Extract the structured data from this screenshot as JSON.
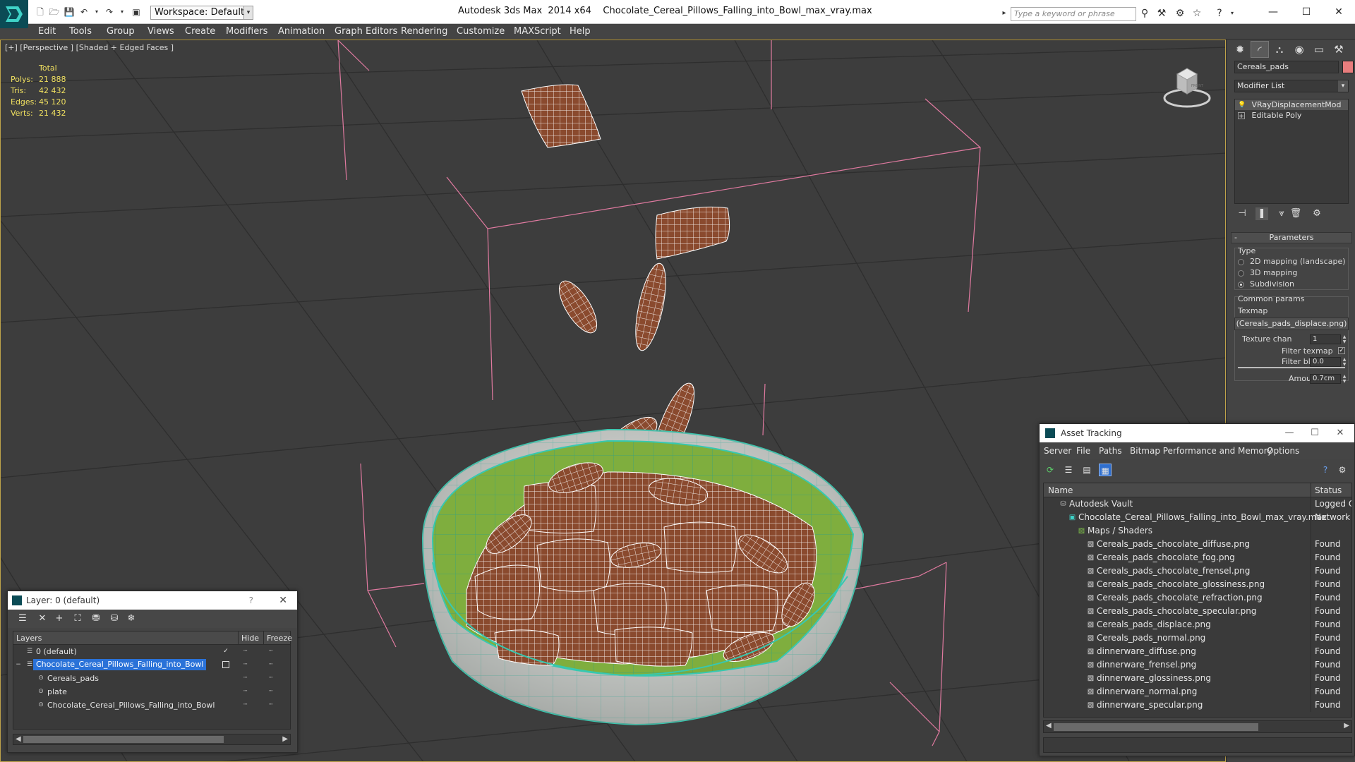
{
  "titlebar": {
    "workspace_label": "Workspace: Default",
    "app_name": "Autodesk 3ds Max  2014 x64",
    "file_name": "Chocolate_Cereal_Pillows_Falling_into_Bowl_max_vray.max",
    "search_placeholder": "Type a keyword or phrase",
    "quick_access_icons": [
      "new-file-icon",
      "open-file-icon",
      "save-icon",
      "undo-icon",
      "redo-icon",
      "project-icon"
    ],
    "window_buttons": [
      "minimize",
      "maximize",
      "close"
    ]
  },
  "menubar": {
    "items": [
      "Edit",
      "Tools",
      "Group",
      "Views",
      "Create",
      "Modifiers",
      "Animation",
      "Graph Editors",
      "Rendering",
      "Customize",
      "MAXScript",
      "Help"
    ]
  },
  "viewport": {
    "label": "[+] [Perspective ] [Shaded + Edged Faces ]",
    "stats": {
      "header": "Total",
      "polys_label": "Polys:",
      "polys": "21 888",
      "tris_label": "Tris:",
      "tris": "42 432",
      "edges_label": "Edges:",
      "edges": "45 120",
      "verts_label": "Verts:",
      "verts": "21 432"
    },
    "viewcube_face": "FRONT",
    "colors": {
      "background": "#3d3d3d",
      "grid": "#2e2e2e",
      "bounding_box": "#e07aa0",
      "cereal": "#8a4a2e",
      "wire": "#ffffff",
      "bowl_inside": "#7fae3e",
      "bowl_outside": "#cfd2cf",
      "bowl_edges": "#37c8b0"
    }
  },
  "command_panel": {
    "tabs": [
      "create-icon",
      "modify-icon",
      "hierarchy-icon",
      "motion-icon",
      "display-icon",
      "utilities-icon"
    ],
    "object_name": "Cereals_pads",
    "object_color": "#e87d7d",
    "modifier_list_label": "Modifier List",
    "stack": [
      {
        "label": "VRayDisplacementMod",
        "selected": true
      },
      {
        "label": "Editable Poly",
        "selected": false
      }
    ],
    "params": {
      "title": "Parameters",
      "type_label": "Type",
      "type_options": [
        {
          "label": "2D mapping (landscape)",
          "selected": false
        },
        {
          "label": "3D mapping",
          "selected": false
        },
        {
          "label": "Subdivision",
          "selected": true
        }
      ],
      "common_label": "Common params",
      "texmap_label": "Texmap",
      "texmap_value": "(Cereals_pads_displace.png)",
      "texture_chan_label": "Texture chan",
      "texture_chan_value": "1",
      "filter_texmap_label": "Filter texmap",
      "filter_texmap_checked": true,
      "filter_blur_label": "Filter blur",
      "filter_blur_value": "0.0",
      "amount_label": "Amount",
      "amount_value": "0.7cm"
    }
  },
  "layer_window": {
    "title": "Layer: 0 (default)",
    "help": "?",
    "toolbar_icons": [
      "layer-manager-icon",
      "delete-layer-icon",
      "add-layer-icon",
      "select-layer-icon",
      "highlight-layer-icon",
      "hide-layers-icon",
      "freeze-layers-icon"
    ],
    "columns": [
      "Layers",
      "Hide",
      "Freeze"
    ],
    "rows": [
      {
        "name": "0 (default)",
        "indent": 0,
        "selected": false,
        "active": true
      },
      {
        "name": "Chocolate_Cereal_Pillows_Falling_into_Bowl",
        "indent": 0,
        "selected": true,
        "active": false
      },
      {
        "name": "Cereals_pads",
        "indent": 1,
        "selected": false,
        "active": false
      },
      {
        "name": "plate",
        "indent": 1,
        "selected": false,
        "active": false
      },
      {
        "name": "Chocolate_Cereal_Pillows_Falling_into_Bowl",
        "indent": 1,
        "selected": false,
        "active": false
      }
    ]
  },
  "asset_window": {
    "title": "Asset Tracking",
    "menu": [
      "Server",
      "File",
      "Paths",
      "Bitmap Performance and Memory",
      "Options"
    ],
    "toolbar_icons": [
      "refresh-icon",
      "list-view-icon",
      "thumbnail-view-icon",
      "table-view-icon"
    ],
    "columns": [
      "Name",
      "Status"
    ],
    "rows": [
      {
        "name": "Autodesk Vault",
        "status": "Logged O",
        "level": 0,
        "icon": "vault-icon"
      },
      {
        "name": "Chocolate_Cereal_Pillows_Falling_into_Bowl_max_vray.max",
        "status": "Network P",
        "level": 1,
        "icon": "max-file-icon"
      },
      {
        "name": "Maps / Shaders",
        "status": "",
        "level": 2,
        "icon": "maps-folder-icon"
      },
      {
        "name": "Cereals_pads_chocolate_diffuse.png",
        "status": "Found",
        "level": 3,
        "icon": "bitmap-icon"
      },
      {
        "name": "Cereals_pads_chocolate_fog.png",
        "status": "Found",
        "level": 3,
        "icon": "bitmap-icon"
      },
      {
        "name": "Cereals_pads_chocolate_frensel.png",
        "status": "Found",
        "level": 3,
        "icon": "bitmap-icon"
      },
      {
        "name": "Cereals_pads_chocolate_glossiness.png",
        "status": "Found",
        "level": 3,
        "icon": "bitmap-icon"
      },
      {
        "name": "Cereals_pads_chocolate_refraction.png",
        "status": "Found",
        "level": 3,
        "icon": "bitmap-icon"
      },
      {
        "name": "Cereals_pads_chocolate_specular.png",
        "status": "Found",
        "level": 3,
        "icon": "bitmap-icon"
      },
      {
        "name": "Cereals_pads_displace.png",
        "status": "Found",
        "level": 3,
        "icon": "bitmap-icon"
      },
      {
        "name": "Cereals_pads_normal.png",
        "status": "Found",
        "level": 3,
        "icon": "bitmap-icon"
      },
      {
        "name": "dinnerware_diffuse.png",
        "status": "Found",
        "level": 3,
        "icon": "bitmap-icon"
      },
      {
        "name": "dinnerware_frensel.png",
        "status": "Found",
        "level": 3,
        "icon": "bitmap-icon"
      },
      {
        "name": "dinnerware_glossiness.png",
        "status": "Found",
        "level": 3,
        "icon": "bitmap-icon"
      },
      {
        "name": "dinnerware_normal.png",
        "status": "Found",
        "level": 3,
        "icon": "bitmap-icon"
      },
      {
        "name": "dinnerware_specular.png",
        "status": "Found",
        "level": 3,
        "icon": "bitmap-icon"
      }
    ]
  }
}
